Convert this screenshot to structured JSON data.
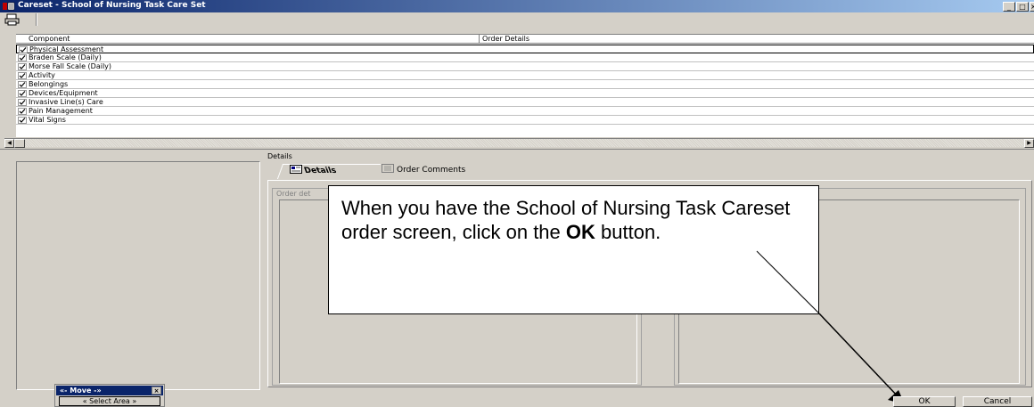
{
  "window": {
    "title": "Careset - School of Nursing Task Care Set",
    "minimize": "_",
    "maximize": "□",
    "close": "×"
  },
  "grid": {
    "columns": [
      "Component",
      "Order Details"
    ],
    "rows": [
      {
        "label": "Physical Assessment",
        "checked": true
      },
      {
        "label": "Braden Scale (Daily)",
        "checked": true
      },
      {
        "label": "Morse Fall Scale (Daily)",
        "checked": true
      },
      {
        "label": "Activity",
        "checked": true
      },
      {
        "label": "Belongings",
        "checked": true
      },
      {
        "label": "Devices/Equipment",
        "checked": true
      },
      {
        "label": "Invasive Line(s) Care",
        "checked": true
      },
      {
        "label": "Pain Management",
        "checked": true
      },
      {
        "label": "Vital Signs",
        "checked": true
      }
    ]
  },
  "details": {
    "section_label": "Details",
    "tabs": [
      "Details",
      "Order Comments"
    ],
    "order_group_label": "Order det"
  },
  "callout": {
    "text_before": "When you have the School of Nursing Task Careset order screen, click on the ",
    "text_bold": "OK",
    "text_after": " button."
  },
  "move_widget": {
    "title": "«- Move -»",
    "close": "×",
    "select_area": "« Select Area »"
  },
  "buttons": {
    "ok": "OK",
    "cancel": "Cancel"
  },
  "colors": {
    "titlebar": "#0a246a",
    "face": "#d4d0c8"
  }
}
